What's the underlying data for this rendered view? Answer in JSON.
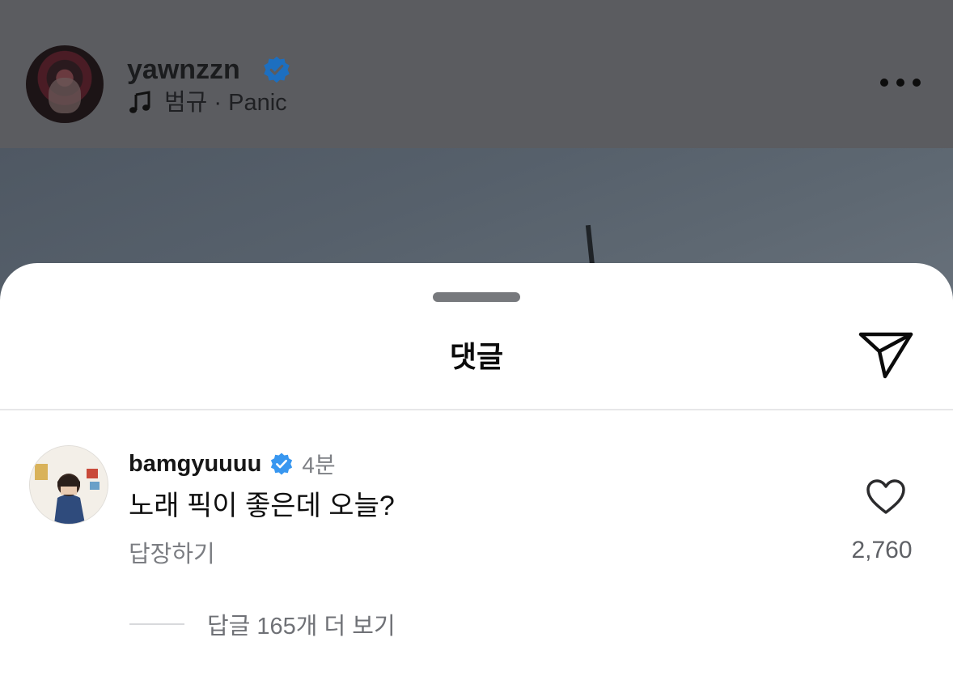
{
  "post": {
    "username": "yawnzzn",
    "music": "범규 · Panic",
    "more_icon": "more-horizontal-icon",
    "verified_color": "#1d6fc0"
  },
  "sheet": {
    "title": "댓글",
    "share_icon": "send-icon"
  },
  "comment": {
    "username": "bamgyuuuu",
    "time": "4분",
    "text": "노래 픽이 좋은데 오늘?",
    "reply_label": "답장하기",
    "like_count": "2,760",
    "view_replies": "답글 165개 더 보기",
    "verified_color": "#3897f0"
  }
}
